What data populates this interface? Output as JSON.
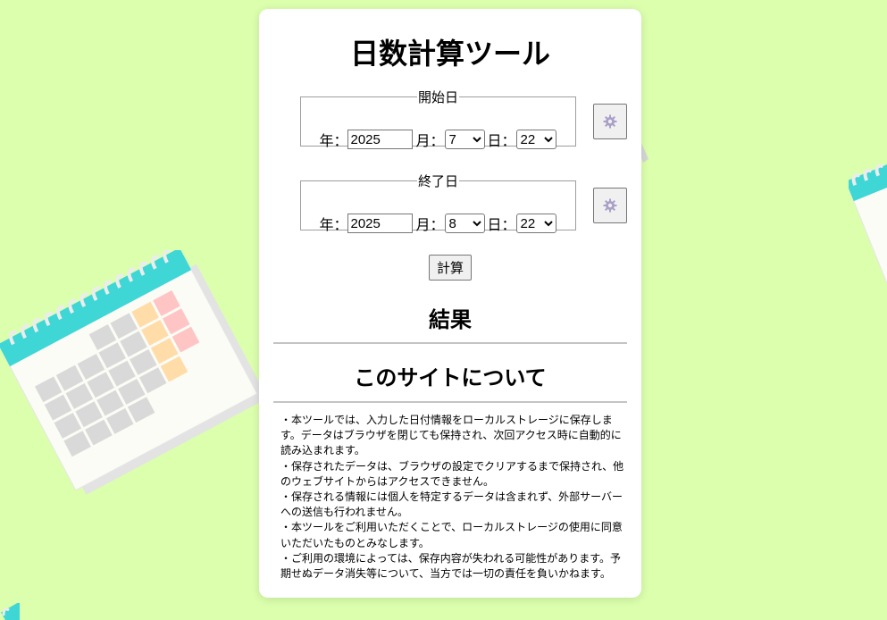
{
  "title": "日数計算ツール",
  "start": {
    "legend": "開始日",
    "year_label": "年：",
    "year": "2025",
    "month_label": "月：",
    "month": "7",
    "day_label": "日：",
    "day": "22"
  },
  "end": {
    "legend": "終了日",
    "year_label": "年：",
    "year": "2025",
    "month_label": "月：",
    "month": "8",
    "day_label": "日：",
    "day": "22"
  },
  "calc_button": "計算",
  "result_heading": "結果",
  "about_heading": "このサイトについて",
  "about_lines": [
    "・本ツールでは、入力した日付情報をローカルストレージに保存します。データはブラウザを閉じても保持され、次回アクセス時に自動的に読み込まれます。",
    "・保存されたデータは、ブラウザの設定でクリアするまで保持され、他のウェブサイトからはアクセスできません。",
    "・保存される情報には個人を特定するデータは含まれず、外部サーバーへの送信も行われません。",
    "・本ツールをご利用いただくことで、ローカルストレージの使用に同意いただいたものとみなします。",
    "・ご利用の環境によっては、保存内容が失われる可能性があります。予期せぬデータ消失等について、当方では一切の責任を負いかねます。"
  ],
  "colors": {
    "background": "#dbffad",
    "calendar_ring": "#3fd6d6",
    "weekday_cell": "#d9d9d9",
    "saturday_cell": "#ffdca8",
    "sunday_cell": "#ffc4c4"
  },
  "icons": {
    "gear": "gear-icon",
    "calendar": "calendar-icon"
  }
}
